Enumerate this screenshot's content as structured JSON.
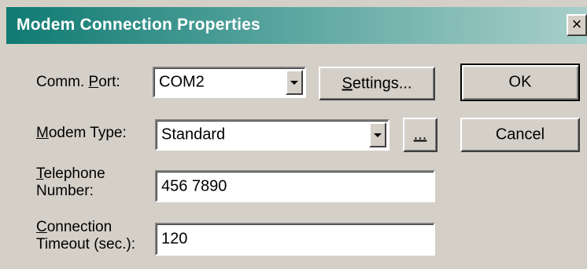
{
  "window": {
    "title": "Modem Connection Properties",
    "close_glyph": "×"
  },
  "form": {
    "comm_port": {
      "label_pre": "Comm. ",
      "label_ul": "P",
      "label_post": "ort:",
      "value": "COM2"
    },
    "modem_type": {
      "label_ul": "M",
      "label_post": "odem Type:",
      "value": "Standard"
    },
    "telephone": {
      "label_ul": "T",
      "label_line1_post": "elephone",
      "label_line2": "Number:",
      "value": "456 7890"
    },
    "timeout": {
      "label_ul": "C",
      "label_line1_post": "onnection",
      "label_line2": "Timeout (sec.):",
      "value": "120"
    }
  },
  "buttons": {
    "settings_ul": "S",
    "settings_post": "ettings...",
    "ellipsis": "...",
    "ok": "OK",
    "cancel": "Cancel"
  },
  "icons": {
    "dropdown": "chevron-down-icon",
    "close": "close-icon"
  }
}
